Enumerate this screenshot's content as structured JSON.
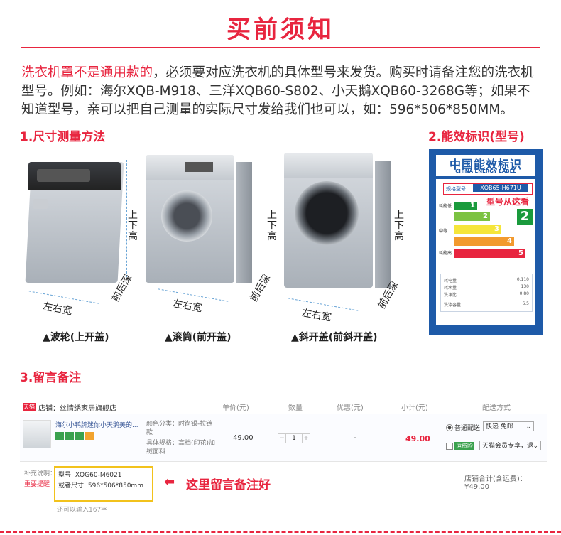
{
  "title": "买前须知",
  "intro": {
    "red_part": "洗衣机罩不是通用款的",
    "rest": "，必须要对应洗衣机的具体型号来发货。购买时请备注您的洗衣机型号。例如：海尔XQB-M918、三洋XQB60-S802、小天鹅XQB60-3268G等；如果不知道型号，亲可以把自己测量的实际尺寸发给我们也可以，如：596*506*850MM。"
  },
  "section1": "1.尺寸测量方法",
  "section2": "2.能效标识(型号)",
  "section3": "3.留言备注",
  "dims": {
    "height": "上下高",
    "depth": "前后深",
    "width": "左右宽"
  },
  "captions": [
    "▲波轮(上开盖)",
    "▲滚筒(前开盖)",
    "▲斜开盖(前斜开盖)"
  ],
  "energy_label": {
    "title_cn": "中国能效标识",
    "title_en": "CHINA ENERGY LABEL",
    "model_label": "规格型号",
    "model_value": "XQB65-H671U",
    "hint": "型号从这看",
    "grade_low": "耗能低",
    "grade_mid": "中等",
    "grade_high": "耗能高",
    "level": "2",
    "levels": [
      "1",
      "2",
      "3",
      "4",
      "5"
    ],
    "specs": [
      {
        "name": "耗电量",
        "value": "0.110"
      },
      {
        "name": "耗水量",
        "value": "130"
      },
      {
        "name": "洗净比",
        "value": "0.80"
      },
      {
        "name": "洗涤容量",
        "value": "6.5"
      }
    ]
  },
  "shop": {
    "store_tag": "天猫",
    "store_name": "店铺：丝情绣家居旗舰店",
    "headers": [
      "单价(元)",
      "数量",
      "优惠(元)",
      "小计(元)",
      "配送方式"
    ],
    "product_name": "海尔小鸭牌迷你小天鹅美的...",
    "color_label": "颜色分类：时尚银-拉链款",
    "spec_label": "具体规格：高档(印花)加绒面料",
    "price": "49.00",
    "qty": "1",
    "discount": "-",
    "subtotal": "49.00",
    "ship_normal": "普通配送",
    "ship_value": "快递 免邮",
    "insurance_tag": "运费险",
    "insurance_value": "天猫会员专享，退",
    "note_label": "补充说明：",
    "note_warn": "重要提醒",
    "note_line1": "型号: XQG60-M6021",
    "note_line2": "或者尺寸: 596*506*850mm",
    "note_counter": "还可以输入167字",
    "callout": "这里留言备注好",
    "total": "店铺合计(含运费)：¥49.00"
  },
  "colors": {
    "accent": "#e8253f",
    "label_blue": "#1e5aa8",
    "dim_line": "#6aa5d6"
  }
}
